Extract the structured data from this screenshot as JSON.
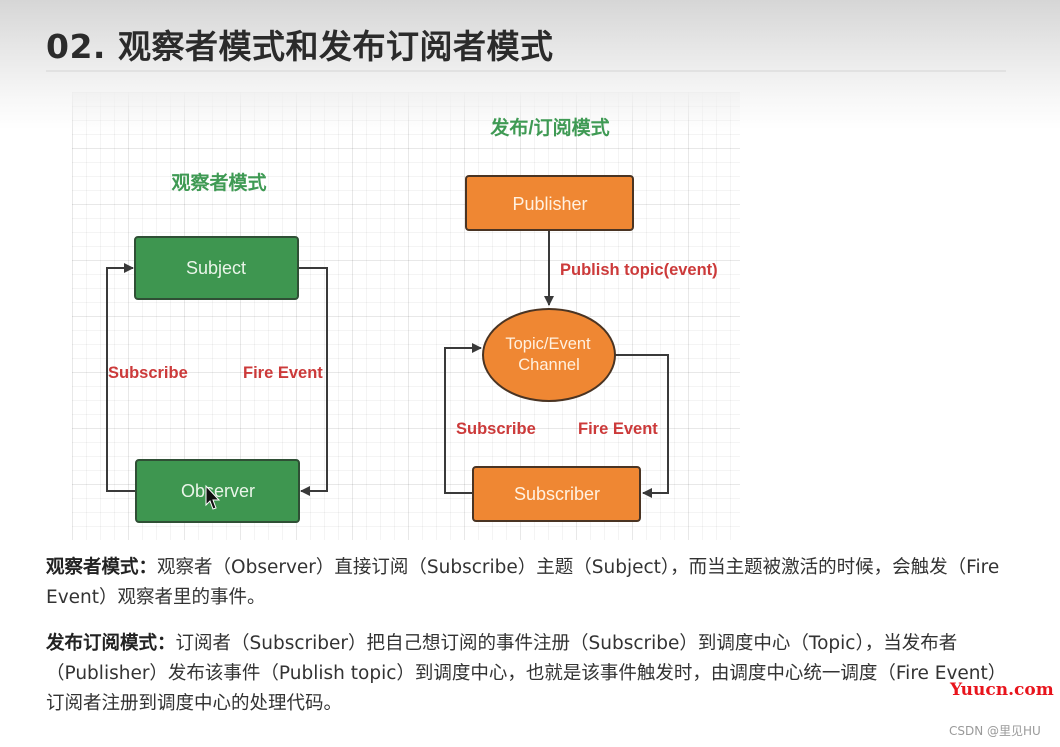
{
  "page": {
    "title": "02. 观察者模式和发布订阅者模式"
  },
  "diagram": {
    "observer_pattern": {
      "heading": "观察者模式",
      "subject_label": "Subject",
      "observer_label": "Observer",
      "subscribe_label": "Subscribe",
      "fire_event_label": "Fire Event",
      "box_color": "#3e9650",
      "heading_color": "#3f9a54"
    },
    "pubsub_pattern": {
      "heading": "发布/订阅模式",
      "publisher_label": "Publisher",
      "channel_label_line1": "Topic/Event",
      "channel_label_line2": "Channel",
      "subscriber_label": "Subscriber",
      "publish_label": "Publish topic(event)",
      "subscribe_label": "Subscribe",
      "fire_event_label": "Fire Event",
      "box_color": "#ef8733"
    },
    "edge_label_color": "#cc3a3a",
    "cursor": "mouse-pointer"
  },
  "paragraphs": {
    "observer": {
      "term": "观察者模式：",
      "text": "观察者（Observer）直接订阅（Subscribe）主题（Subject），而当主题被激活的时候，会触发（Fire Event）观察者里的事件。"
    },
    "pubsub": {
      "term": "发布订阅模式：",
      "text": "订阅者（Subscriber）把自己想订阅的事件注册（Subscribe）到调度中心（Topic），当发布者（Publisher）发布该事件（Publish topic）到调度中心，也就是该事件触发时，由调度中心统一调度（Fire Event）订阅者注册到调度中心的处理代码。"
    }
  },
  "watermarks": {
    "site": "Yuucn.com",
    "csdn": "CSDN @里见HU"
  }
}
